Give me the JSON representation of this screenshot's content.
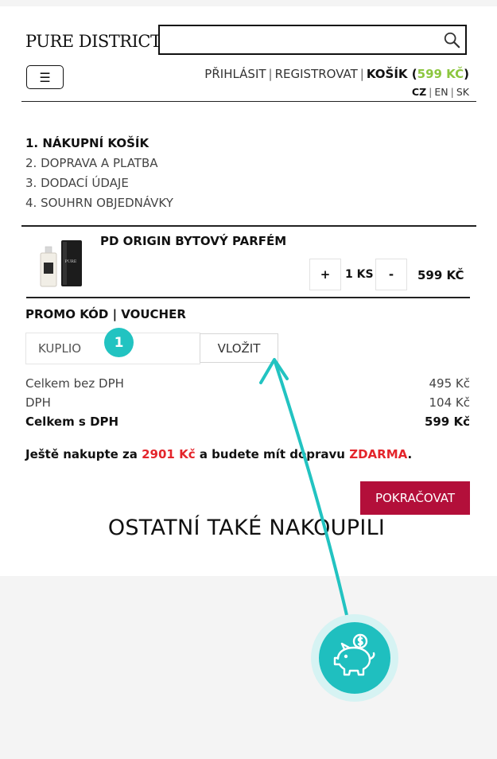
{
  "header": {
    "logo_text": "PURE DISTRICT",
    "search": {
      "placeholder": "",
      "value": ""
    },
    "menu_icon": "☰",
    "account": {
      "login": "PŘIHLÁSIT",
      "register": "REGISTROVAT",
      "cart": "KOŠÍK",
      "cart_total": "599 KČ"
    },
    "languages": [
      "CZ",
      "EN",
      "SK"
    ],
    "active_language": "CZ"
  },
  "steps": [
    "1. NÁKUPNÍ KOŠÍK",
    "2. DOPRAVA A PLATBA",
    "3. DODACÍ ÚDAJE",
    "4. SOUHRN OBJEDNÁVKY"
  ],
  "cart_item": {
    "name": "PD ORIGIN BYTOVÝ PARFÉM",
    "image_label": "PURE",
    "plus": "+",
    "quantity": "1 KS",
    "minus": "-",
    "price": "599 KČ"
  },
  "promo": {
    "title": "PROMO KÓD | VOUCHER",
    "input_value": "KUPLIO",
    "button_label": "VLOŽIT",
    "badge_number": "1"
  },
  "totals": [
    {
      "label": "Celkem bez DPH",
      "value": "495 Kč"
    },
    {
      "label": "DPH",
      "value": "104 Kč"
    },
    {
      "label": "Celkem s DPH",
      "value": "599 Kč"
    }
  ],
  "shipping_note": {
    "prefix": "Ještě nakupte za ",
    "amount": "2901 Kč",
    "middle": " a budete mít dopravu ",
    "free": "ZDARMA",
    "suffix": "."
  },
  "continue_button": "POKRAČOVAT",
  "section_title": "OSTATNÍ TAKÉ NAKOUPILI",
  "colors": {
    "accent_green": "#8cc63f",
    "button_red": "#b30f3a",
    "highlight_red": "#e4252b",
    "teal": "#22c3c1"
  },
  "icons": {
    "search": "search-icon",
    "menu": "hamburger-menu-icon",
    "piggy": "piggy-bank-dollar-icon",
    "arrow": "curved-arrow-icon"
  }
}
